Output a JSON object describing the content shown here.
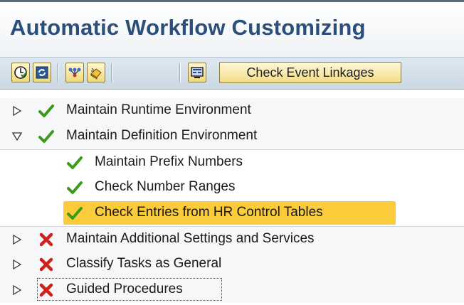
{
  "title": "Automatic Workflow Customizing",
  "toolbar": {
    "buttons": [
      {
        "name": "activate-icon"
      },
      {
        "name": "refresh-icon"
      },
      {
        "name": "network-icon"
      },
      {
        "name": "eraser-icon"
      },
      {
        "name": "display-icon"
      }
    ],
    "check_event_linkages_label": "Check Event Linkages"
  },
  "tree": {
    "items": [
      {
        "label": "Maintain Runtime Environment",
        "status": "ok",
        "expander": "collapsed",
        "level": 0
      },
      {
        "label": "Maintain Definition Environment",
        "status": "ok",
        "expander": "expanded",
        "level": 0
      },
      {
        "label": "Maintain Prefix Numbers",
        "status": "ok",
        "expander": "none",
        "level": 1
      },
      {
        "label": "Check Number Ranges",
        "status": "ok",
        "expander": "none",
        "level": 1
      },
      {
        "label": "Check Entries from HR Control Tables",
        "status": "ok",
        "expander": "none",
        "level": 1,
        "selected": true
      },
      {
        "label": "Maintain Additional Settings and Services",
        "status": "error",
        "expander": "collapsed",
        "level": 0
      },
      {
        "label": "Classify Tasks as General",
        "status": "error",
        "expander": "collapsed",
        "level": 0
      },
      {
        "label": "Guided Procedures",
        "status": "error",
        "expander": "collapsed",
        "level": 0,
        "focused": true
      }
    ]
  },
  "colors": {
    "title": "#2b4f7a",
    "ok": "#3a9a1a",
    "error": "#d0201a",
    "selection": "#fccb3c"
  }
}
